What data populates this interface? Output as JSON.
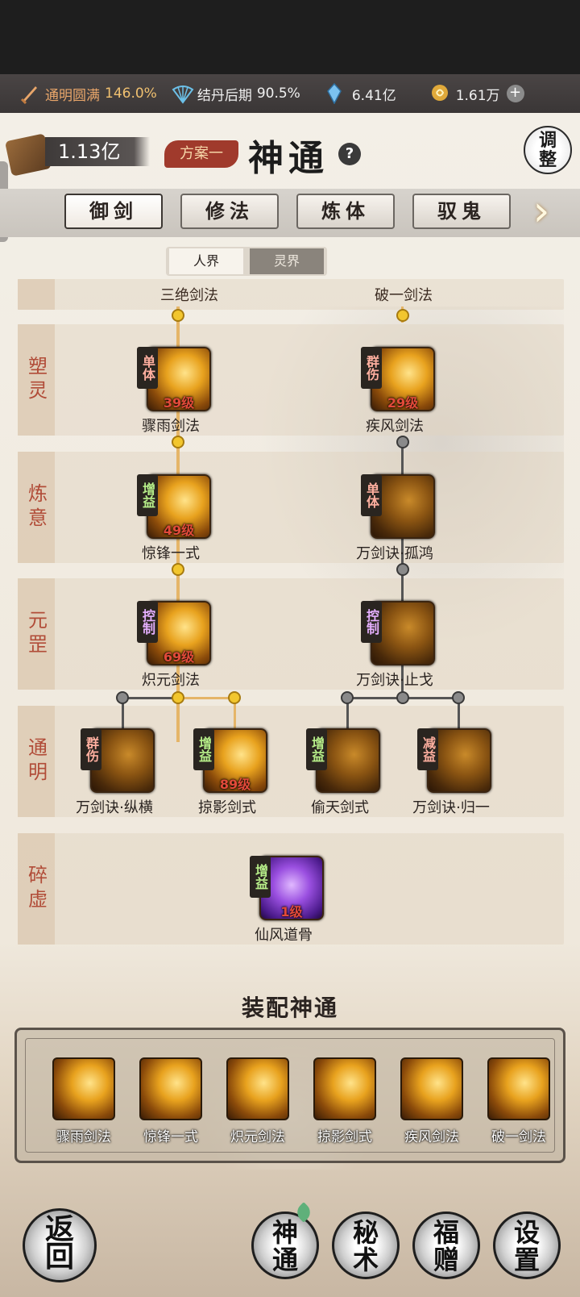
{
  "status": {
    "cultivation_label": "通明圆满",
    "cultivation_value": "146.0%",
    "stage_label": "结丹后期",
    "stage_value": "90.5%",
    "spirit_stones": "6.41亿",
    "gold": "1.61万"
  },
  "header": {
    "coins": "1.13亿",
    "plan": "方案一",
    "title": "神通",
    "help": "?",
    "adjust_top": "调",
    "adjust_bottom": "整"
  },
  "tabs": [
    "御剑",
    "修法",
    "炼体",
    "驭鬼"
  ],
  "realms": [
    "人界",
    "灵界"
  ],
  "tiers": [
    "塑灵",
    "炼意",
    "元罡",
    "通明",
    "碎虚"
  ],
  "top_partial": [
    "三绝剑法",
    "破一剑法"
  ],
  "skills": {
    "s1": {
      "name": "骤雨剑法",
      "tag": "单体",
      "level": "39级"
    },
    "s2": {
      "name": "疾风剑法",
      "tag": "群伤",
      "level": "29级"
    },
    "s3": {
      "name": "惊锋一式",
      "tag": "增益",
      "level": "49级"
    },
    "s4": {
      "name": "万剑诀·孤鸿",
      "tag": "单体",
      "level": ""
    },
    "s5": {
      "name": "炽元剑法",
      "tag": "控制",
      "level": "69级"
    },
    "s6": {
      "name": "万剑诀·止戈",
      "tag": "控制",
      "level": ""
    },
    "s7": {
      "name": "万剑诀·纵横",
      "tag": "群伤",
      "level": ""
    },
    "s8": {
      "name": "掠影剑式",
      "tag": "增益",
      "level": "89级"
    },
    "s9": {
      "name": "偷天剑式",
      "tag": "增益",
      "level": ""
    },
    "s10": {
      "name": "万剑诀·归一",
      "tag": "减益",
      "level": ""
    },
    "s11": {
      "name": "仙风道骨",
      "tag": "增益",
      "level": "1级"
    }
  },
  "equip": {
    "title": "装配神通",
    "slots": [
      "骤雨剑法",
      "惊锋一式",
      "炽元剑法",
      "掠影剑式",
      "疾风剑法",
      "破一剑法"
    ]
  },
  "bottom_nav": {
    "back": [
      "返",
      "回"
    ],
    "shentong": [
      "神",
      "通"
    ],
    "mishu": [
      "秘",
      "术"
    ],
    "fuzeng": [
      "福",
      "赠"
    ],
    "shezhi": [
      "设",
      "置"
    ]
  }
}
